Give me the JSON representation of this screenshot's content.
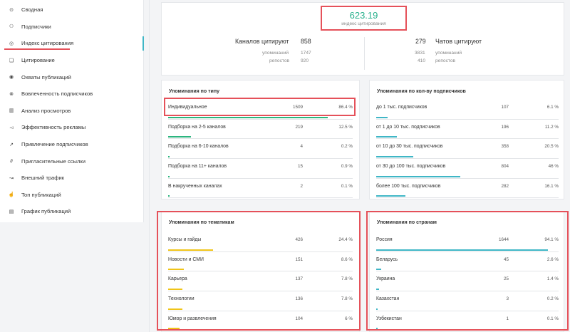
{
  "colors": {
    "green": "#2cb57f",
    "teal": "#3fb6c6",
    "yellow": "#f0c419",
    "red": "#e5515a"
  },
  "sidebar": {
    "items": [
      {
        "label": "Сводная",
        "icon": "grid-icon"
      },
      {
        "label": "Подписчики",
        "icon": "users-icon"
      },
      {
        "label": "Индекс цитирования",
        "icon": "at-icon",
        "active": true
      },
      {
        "label": "Цитирование",
        "icon": "quote-icon"
      },
      {
        "label": "Охваты публикаций",
        "icon": "eye-icon"
      },
      {
        "label": "Вовлеченность подписчиков",
        "icon": "engagement-icon"
      },
      {
        "label": "Анализ просмотров",
        "icon": "bar-chart-icon"
      },
      {
        "label": "Эффективность рекламы",
        "icon": "megaphone-icon"
      },
      {
        "label": "Привлечение подписчиков",
        "icon": "arrow-icon"
      },
      {
        "label": "Пригласительные ссылки",
        "icon": "link-icon"
      },
      {
        "label": "Внешний трафик",
        "icon": "trend-icon"
      },
      {
        "label": "Топ публикаций",
        "icon": "thumb-up-icon"
      },
      {
        "label": "График публикаций",
        "icon": "calendar-icon"
      }
    ]
  },
  "index": {
    "value": "623.19",
    "label": "индекс цитирования"
  },
  "channels": {
    "label": "Каналов цитируют",
    "count": "858",
    "mentions_label": "упоминаний",
    "mentions": "1747",
    "reposts_label": "репостов",
    "reposts": "920"
  },
  "chats": {
    "label": "Чатов цитируют",
    "count": "279",
    "mentions_label": "упоминаний",
    "mentions": "3831",
    "reposts_label": "репостов",
    "reposts": "410"
  },
  "by_type": {
    "title": "Упоминания по типу",
    "rows": [
      {
        "label": "Индивидуальное",
        "count": "1509",
        "pct": "86.4 %",
        "frac": 0.864
      },
      {
        "label": "Подборка на 2-5 каналов",
        "count": "219",
        "pct": "12.5 %",
        "frac": 0.125
      },
      {
        "label": "Подборка на 6-10 каналов",
        "count": "4",
        "pct": "0.2 %",
        "frac": 0.002
      },
      {
        "label": "Подборка на 11+ каналов",
        "count": "15",
        "pct": "0.9 %",
        "frac": 0.009
      },
      {
        "label": "В накрученных каналах",
        "count": "2",
        "pct": "0.1 %",
        "frac": 0.001
      }
    ]
  },
  "by_subs": {
    "title": "Упоминания по кол-ву подписчиков",
    "rows": [
      {
        "label": "до 1 тыс. подписчиков",
        "count": "107",
        "pct": "6.1 %",
        "frac": 0.061
      },
      {
        "label": "от 1 до 10 тыс. подписчиков",
        "count": "196",
        "pct": "11.2 %",
        "frac": 0.112
      },
      {
        "label": "от 10 до 30 тыс. подписчиков",
        "count": "358",
        "pct": "20.5 %",
        "frac": 0.205
      },
      {
        "label": "от 30 до 100 тыс. подписчиков",
        "count": "804",
        "pct": "46 %",
        "frac": 0.46
      },
      {
        "label": "более 100 тыс. подписчиков",
        "count": "282",
        "pct": "16.1 %",
        "frac": 0.161
      }
    ]
  },
  "by_topic": {
    "title": "Упоминания по тематикам",
    "rows": [
      {
        "label": "Курсы и гайды",
        "count": "426",
        "pct": "24.4 %",
        "frac": 0.244
      },
      {
        "label": "Новости и СМИ",
        "count": "151",
        "pct": "8.6 %",
        "frac": 0.086
      },
      {
        "label": "Карьера",
        "count": "137",
        "pct": "7.8 %",
        "frac": 0.078
      },
      {
        "label": "Технологии",
        "count": "136",
        "pct": "7.8 %",
        "frac": 0.078
      },
      {
        "label": "Юмор и развлечения",
        "count": "104",
        "pct": "6 %",
        "frac": 0.06
      }
    ]
  },
  "by_country": {
    "title": "Упоминания по странам",
    "rows": [
      {
        "label": "Россия",
        "count": "1644",
        "pct": "94.1 %",
        "frac": 0.941
      },
      {
        "label": "Беларусь",
        "count": "45",
        "pct": "2.6 %",
        "frac": 0.026
      },
      {
        "label": "Украина",
        "count": "25",
        "pct": "1.4 %",
        "frac": 0.014
      },
      {
        "label": "Казахстан",
        "count": "3",
        "pct": "0.2 %",
        "frac": 0.002
      },
      {
        "label": "Узбекистан",
        "count": "1",
        "pct": "0.1 %",
        "frac": 0.001
      }
    ]
  }
}
